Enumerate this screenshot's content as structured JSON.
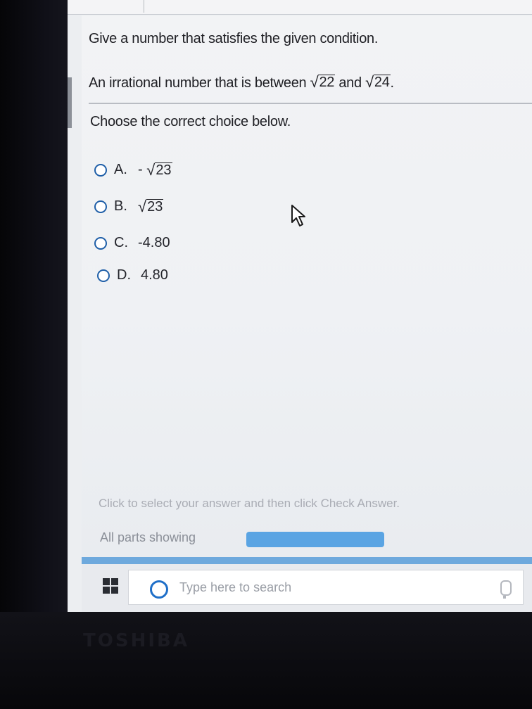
{
  "question": {
    "instruction": "Give a number that satisfies the given condition.",
    "text_prefix": "An irrational number that is between",
    "lower_radicand": "22",
    "conjunction": "and",
    "upper_radicand": "24",
    "text_suffix": "."
  },
  "prompt": "Choose the correct choice below.",
  "choices": [
    {
      "label": "A.",
      "prefix": "-",
      "radicand": "23",
      "value": ""
    },
    {
      "label": "B.",
      "prefix": "",
      "radicand": "23",
      "value": ""
    },
    {
      "label": "C.",
      "prefix": "",
      "radicand": "",
      "value": "-4.80"
    },
    {
      "label": "D.",
      "prefix": "",
      "radicand": "",
      "value": "4.80"
    }
  ],
  "footer": {
    "hint": "Click to select your answer and then click Check Answer.",
    "parts_label": "All parts showing"
  },
  "taskbar": {
    "search_placeholder": "Type here to search"
  },
  "device_brand": "TOSHIBA",
  "colors": {
    "radio_border": "#1f5fa8",
    "progress_bar": "#5aa4e3",
    "search_accent": "#1f6fc8"
  }
}
